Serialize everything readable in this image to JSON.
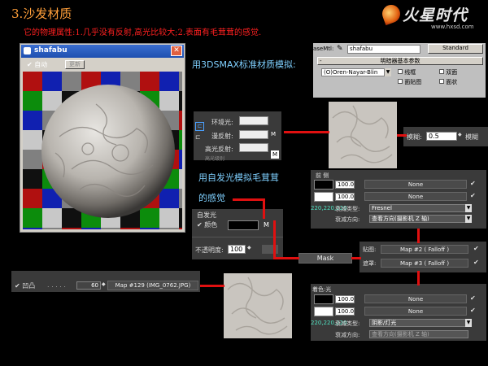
{
  "colors": {
    "heading": "#ff9f3a",
    "red_text": "#ff2020",
    "caption": "#7fd0ff",
    "line": "#e01010",
    "swatch_black": "#000000",
    "swatch_white": "#ffffff"
  },
  "header": {
    "title": "3.沙发材质",
    "subtitle": "它的物理属性:1.几乎没有反射,高光比较大;2.表面有毛茸茸的感觉.",
    "logo_text": "火星时代",
    "logo_url": "www.hxsd.com"
  },
  "preview_window": {
    "title": "shafabu",
    "close_glyph": "✕",
    "auto_label": "自动",
    "update_label": "更新"
  },
  "captions": {
    "std_material": "用3DSMAX标准材质模拟:",
    "selfillum_line1": "用自发光模拟毛茸茸",
    "selfillum_line2": "的感觉"
  },
  "mtl_header": {
    "label": "aseMtl:",
    "name": "shafabu",
    "type": "Standard",
    "rollout": "明暗器基本参数",
    "shader": "(O)Oren-Nayar-Blin",
    "wire": "线框",
    "two_sided": "双面",
    "face_map": "面贴图",
    "faceted": "面状"
  },
  "basic_params": {
    "ambient": "环境光:",
    "diffuse": "漫反射:",
    "specular": "高光反射:",
    "cut_text": "高光级别"
  },
  "blur": {
    "label": "模糊:",
    "value": "0.5",
    "label2": "模糊"
  },
  "self_illum": {
    "title": "自发光",
    "color_label": "颜色",
    "map_glyph": "M",
    "opacity_label": "不透明度:",
    "opacity_value": "100"
  },
  "falloff_top": {
    "title": "前 侧",
    "rows": [
      {
        "value": "100.0",
        "map": "None"
      },
      {
        "value": "100.0",
        "map": "None"
      }
    ],
    "type_label": "衰减类型:",
    "type_value": "Fresnel",
    "dir_label": "衰减方向:",
    "dir_value": "查看方向(摄影机 Z 轴)",
    "rgb": "220,220,220"
  },
  "mask": {
    "label": "Mask"
  },
  "mask_maps": {
    "map_label": "贴图:",
    "map_value": "Map #2  ( Falloff )",
    "mask_label": "遮罩:",
    "mask_value": "Map #3  ( Falloff )"
  },
  "falloff_bottom": {
    "title": "着色:光",
    "rows": [
      {
        "value": "100.0",
        "map": "None"
      },
      {
        "value": "100.0",
        "map": "None"
      }
    ],
    "type_label": "衰减类型:",
    "type_value": "阴影/灯光",
    "dir_label": "衰减方向:",
    "dir_value": "查看方向(摄影机 Z 轴)",
    "rgb": "220,220,220"
  },
  "bump": {
    "label": "凹凸",
    "dots": ". . . . .",
    "value": "60",
    "map": "Map #129  (IMG_0762.JPG)"
  }
}
